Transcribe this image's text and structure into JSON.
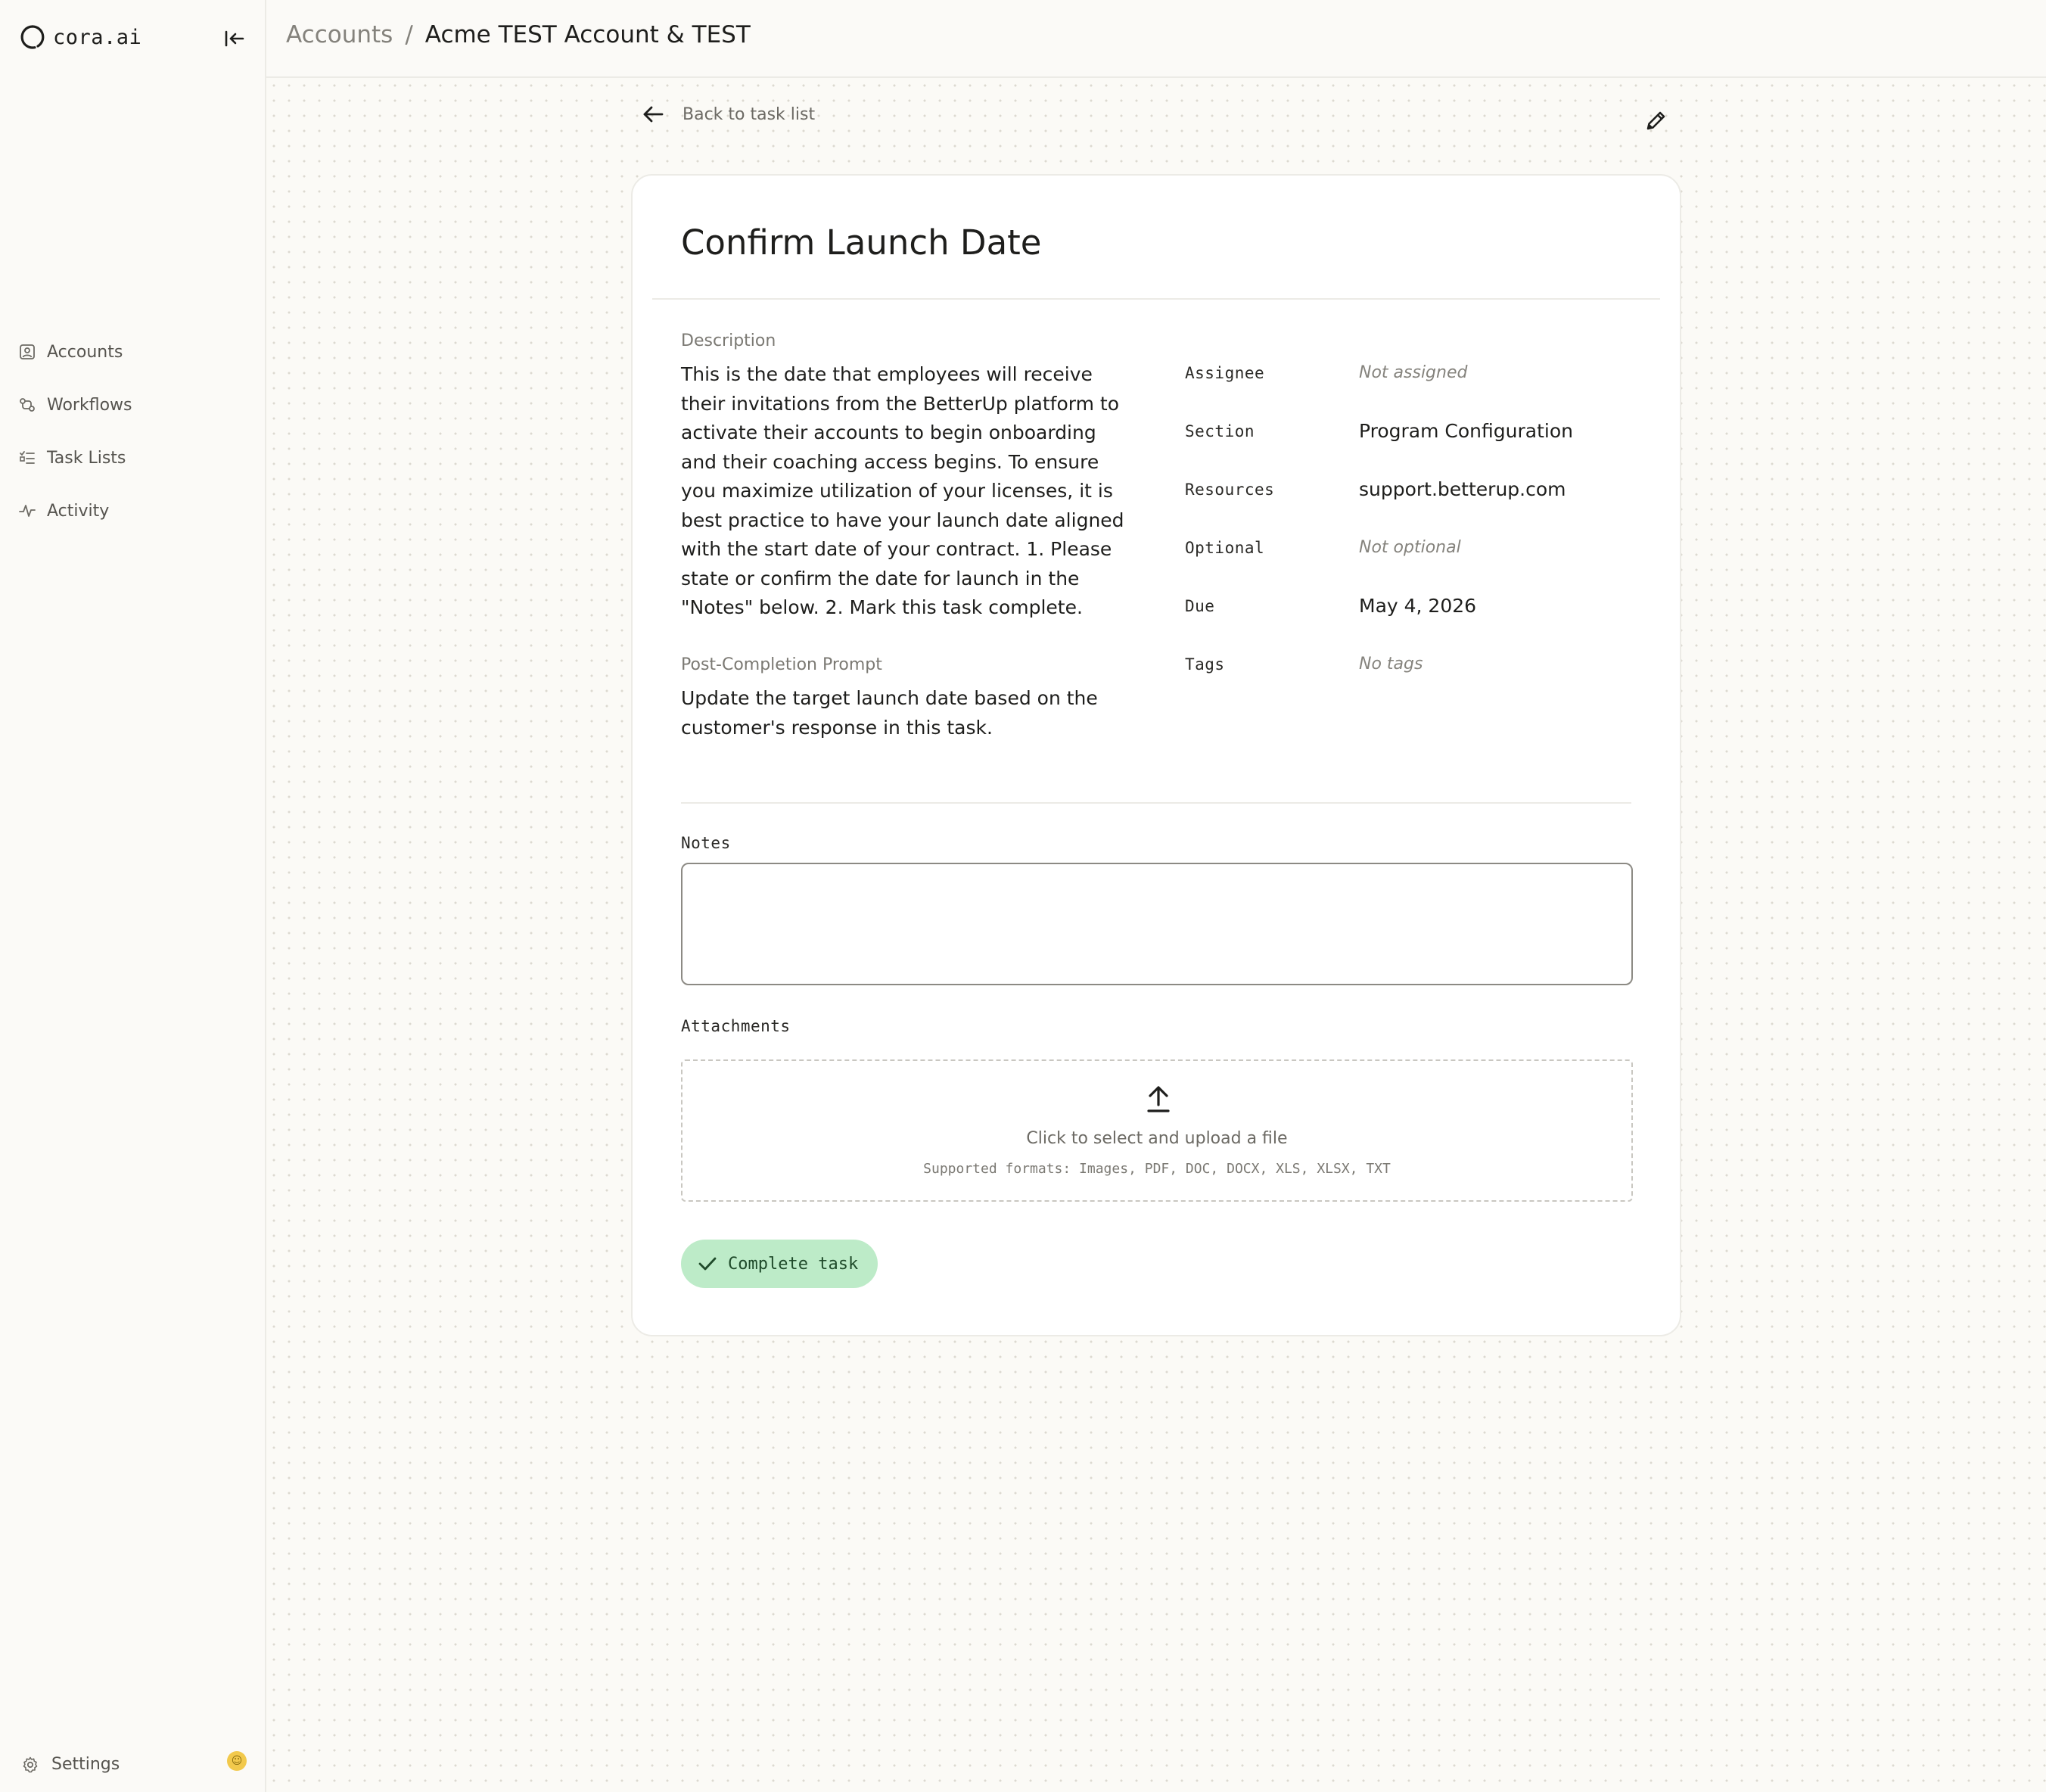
{
  "app": {
    "brand": "cora.ai"
  },
  "sidebar": {
    "items": [
      {
        "label": "Accounts",
        "icon": "accounts-icon"
      },
      {
        "label": "Workflows",
        "icon": "workflows-icon"
      },
      {
        "label": "Task Lists",
        "icon": "task-list-icon"
      },
      {
        "label": "Activity",
        "icon": "activity-icon"
      }
    ],
    "settings_label": "Settings"
  },
  "breadcrumb": {
    "root": "Accounts",
    "separator": "/",
    "current": "Acme TEST Account & TEST"
  },
  "nav": {
    "back_label": "Back to task list"
  },
  "task": {
    "title": "Confirm Launch Date",
    "description_label": "Description",
    "description": "This is the date that employees will receive their invitations from the BetterUp platform to activate their accounts to begin onboarding and their coaching access begins. To ensure you maximize utilization of your licenses, it is best practice to have your launch date aligned with the start date of your contract. 1. Please state or confirm the date for launch in the \"Notes\" below. 2. Mark this task complete.",
    "post_label": "Post-Completion Prompt",
    "post_prompt": "Update the target launch date based on the customer's response in this task.",
    "meta": {
      "assignee_key": "Assignee",
      "assignee_val": "Not assigned",
      "section_key": "Section",
      "section_val": "Program Configuration",
      "resources_key": "Resources",
      "resources_val": "support.betterup.com",
      "optional_key": "Optional",
      "optional_val": "Not optional",
      "due_key": "Due",
      "due_val": "May 4, 2026",
      "tags_key": "Tags",
      "tags_val": "No tags"
    },
    "notes_label": "Notes",
    "notes_value": "",
    "attachments_label": "Attachments",
    "upload_text": "Click to select and upload a file",
    "upload_formats": "Supported formats: Images, PDF, DOC, DOCX, XLS, XLSX, TXT",
    "complete_label": "Complete task"
  },
  "colors": {
    "accent_green": "#bdebc8",
    "notify": "#f2c94c"
  }
}
